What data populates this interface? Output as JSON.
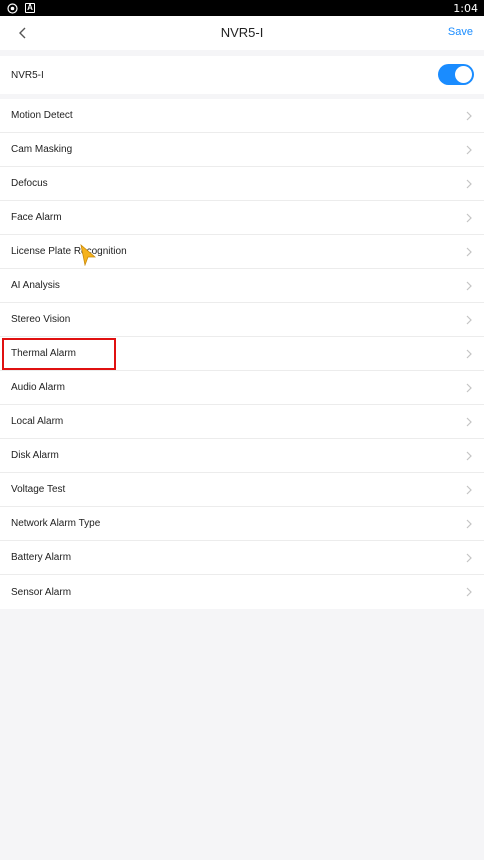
{
  "status_bar": {
    "time": "1:04",
    "icons": [
      "target-icon",
      "a-badge-icon"
    ]
  },
  "header": {
    "title": "NVR5-I",
    "back_icon": "chevron-left-icon",
    "save_label": "Save"
  },
  "device": {
    "name": "NVR5-I",
    "enabled": true
  },
  "menu": {
    "items": [
      {
        "label": "Motion Detect"
      },
      {
        "label": "Cam Masking"
      },
      {
        "label": "Defocus"
      },
      {
        "label": "Face Alarm"
      },
      {
        "label": "License Plate Recognition"
      },
      {
        "label": "AI Analysis"
      },
      {
        "label": "Stereo Vision"
      },
      {
        "label": "Thermal Alarm"
      },
      {
        "label": "Audio Alarm"
      },
      {
        "label": "Local Alarm"
      },
      {
        "label": "Disk Alarm"
      },
      {
        "label": "Voltage Test"
      },
      {
        "label": "Network Alarm Type"
      },
      {
        "label": "Battery Alarm"
      },
      {
        "label": "Sensor Alarm"
      }
    ]
  },
  "colors": {
    "accent": "#1a8cff",
    "highlight": "#e01010",
    "cursor": "#f5b21c"
  }
}
